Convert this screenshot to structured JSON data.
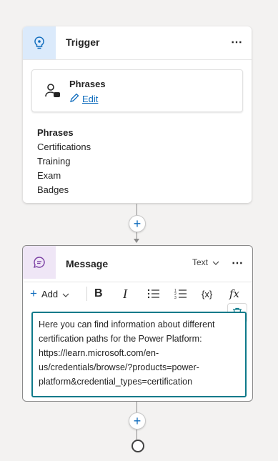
{
  "trigger": {
    "title": "Trigger",
    "more_label": "⋯",
    "icon": "lightbulb-icon",
    "phrases_box": {
      "title": "Phrases",
      "edit_label": "Edit"
    },
    "phrase_list": {
      "header": "Phrases",
      "items": [
        "Certifications",
        "Training",
        "Exam",
        "Badges"
      ]
    }
  },
  "connector": {
    "add_label": "+"
  },
  "message": {
    "title": "Message",
    "icon": "chat-bubble-icon",
    "type_select": "Text",
    "more_label": "⋯",
    "toolbar": {
      "add_label": "Add",
      "bold": "B",
      "italic": "I",
      "variable": "{x}",
      "formula": "fx"
    },
    "body": "Here you can find information about different certification paths for the Power Platform: https://learn.microsoft.com/en-us/credentials/browse/?products=power-platform&credential_types=certification"
  },
  "colors": {
    "accent": "#0f6cbd",
    "editor_border": "#0e7a8a",
    "trigger_tile": "#dbeafb",
    "message_tile": "#efe6f6"
  }
}
